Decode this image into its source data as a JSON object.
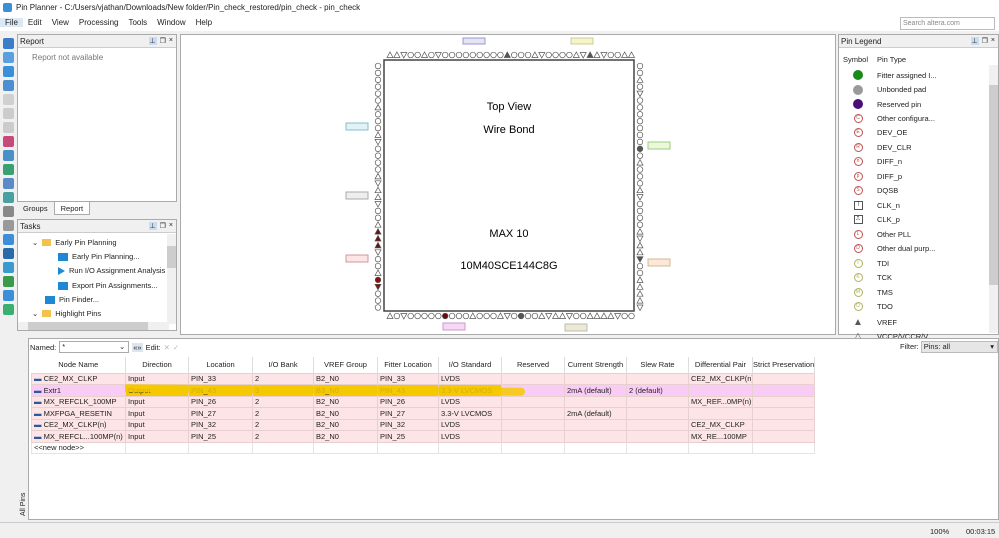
{
  "window": {
    "title": "Pin Planner - C:/Users/vjathan/Downloads/New folder/Pin_check_restored/pin_check - pin_check"
  },
  "menu": [
    "File",
    "Edit",
    "View",
    "Processing",
    "Tools",
    "Window",
    "Help"
  ],
  "search": {
    "placeholder": "Search altera.com"
  },
  "report": {
    "title": "Report",
    "message": "Report not available",
    "tabs": [
      "Groups",
      "Report"
    ]
  },
  "tasks": {
    "title": "Tasks",
    "items": [
      "Early Pin Planning",
      "Early Pin Planning...",
      "Run I/O Assignment Analysis",
      "Export Pin Assignments...",
      "Pin Finder...",
      "Highlight Pins"
    ]
  },
  "package": {
    "view": "Top View",
    "bond": "Wire Bond",
    "family": "MAX 10",
    "device": "10M40SCE144C8G"
  },
  "legend": {
    "title": "Pin Legend",
    "headers": [
      "Symbol",
      "Pin Type"
    ],
    "items": [
      {
        "label": "Fitter assigned I...",
        "icon": "filled-circle",
        "color": "#1a8a1a"
      },
      {
        "label": "Unbonded pad",
        "icon": "filled-circle",
        "color": "#9a9a9a"
      },
      {
        "label": "Reserved pin",
        "icon": "filled-circle",
        "color": "#4b0f7a"
      },
      {
        "label": "Other configura...",
        "icon": "C",
        "color": "#c05050"
      },
      {
        "label": "DEV_OE",
        "icon": "E",
        "color": "#c05050"
      },
      {
        "label": "DEV_CLR",
        "icon": "R",
        "color": "#c05050"
      },
      {
        "label": "DIFF_n",
        "icon": "n",
        "color": "#c05050"
      },
      {
        "label": "DIFF_p",
        "icon": "p",
        "color": "#c05050"
      },
      {
        "label": "DQSB",
        "icon": "S",
        "color": "#c05050"
      },
      {
        "label": "CLK_n",
        "icon": "clk-n",
        "color": "#555"
      },
      {
        "label": "CLK_p",
        "icon": "clk-p",
        "color": "#555"
      },
      {
        "label": "Other PLL",
        "icon": "L",
        "color": "#c05050"
      },
      {
        "label": "Other dual purp...",
        "icon": "D",
        "color": "#c05050"
      },
      {
        "label": "TDI",
        "icon": "I",
        "color": "#b0b060"
      },
      {
        "label": "TCK",
        "icon": "K",
        "color": "#b0b060"
      },
      {
        "label": "TMS",
        "icon": "M",
        "color": "#b0b060"
      },
      {
        "label": "TDO",
        "icon": "O",
        "color": "#b0b060"
      },
      {
        "label": "VREF",
        "icon": "filled-triangle",
        "color": "#555"
      },
      {
        "label": "VCCP/VCCR/V...",
        "icon": "triangle",
        "color": "#555"
      }
    ]
  },
  "table": {
    "named_label": "Named:",
    "named_value": "*",
    "edit_label": "Edit:",
    "filter_label": "Filter:",
    "filter_value": "Pins: all",
    "headers": [
      "Node Name",
      "Direction",
      "Location",
      "I/O Bank",
      "VREF Group",
      "Fitter Location",
      "I/O Standard",
      "Reserved",
      "Current Strength",
      "Slew Rate",
      "Differential Pair",
      "Strict Preservation"
    ],
    "rows": [
      [
        "CE2_MX_CLKP",
        "Input",
        "PIN_33",
        "2",
        "B2_N0",
        "PIN_33",
        "LVDS",
        "",
        "",
        "",
        "CE2_MX_CLKP(n)",
        ""
      ],
      [
        "Extr1",
        "Output",
        "PIN_43",
        "3",
        "B3_N0",
        "PIN_43",
        "3.3-V LVCMOS",
        "",
        "2mA (default)",
        "2 (default)",
        "",
        ""
      ],
      [
        "MX_REFCLK_100MP",
        "Input",
        "PIN_26",
        "2",
        "B2_N0",
        "PIN_26",
        "LVDS",
        "",
        "",
        "",
        "MX_REF...0MP(n)",
        ""
      ],
      [
        "MXFPGA_RESETIN",
        "Input",
        "PIN_27",
        "2",
        "B2_N0",
        "PIN_27",
        "3.3-V LVCMOS",
        "",
        "2mA (default)",
        "",
        "",
        ""
      ],
      [
        "CE2_MX_CLKP(n)",
        "Input",
        "PIN_32",
        "2",
        "B2_N0",
        "PIN_32",
        "LVDS",
        "",
        "",
        "",
        "CE2_MX_CLKP",
        ""
      ],
      [
        "MX_REFCL...100MP(n)",
        "Input",
        "PIN_25",
        "2",
        "B2_N0",
        "PIN_25",
        "LVDS",
        "",
        "",
        "",
        "MX_RE...100MP",
        ""
      ]
    ],
    "new_node": "<<new node>>",
    "side_tab": "All Pins"
  },
  "status": {
    "zoom": "100%",
    "time": "00:03:15"
  }
}
